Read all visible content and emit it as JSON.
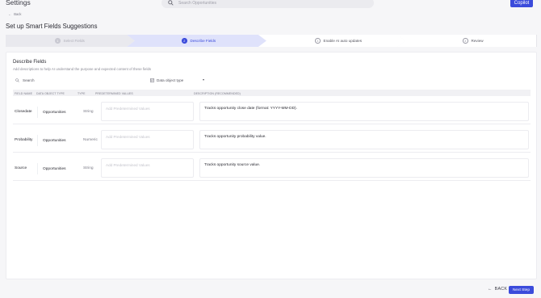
{
  "app": {
    "title": "Settings",
    "copilot_label": "Copilot"
  },
  "search": {
    "placeholder": "Search Opportunities"
  },
  "nav": {
    "back_label": "Back"
  },
  "page": {
    "title": "Set up Smart Fields Suggestions"
  },
  "steps": [
    {
      "number": "1",
      "label": "Select Fields",
      "state": "completed"
    },
    {
      "number": "2",
      "label": "Describe Fields",
      "state": "active"
    },
    {
      "number": "3",
      "label": "Enable AI auto updates",
      "state": "upcoming"
    },
    {
      "number": "4",
      "label": "Review",
      "state": "upcoming"
    }
  ],
  "section": {
    "title": "Describe Fields",
    "subtitle": "Add descriptions to help AI understand the purpose and expected content of these fields"
  },
  "filters": {
    "search_label": "Search",
    "object_type_label": "Data object type"
  },
  "table": {
    "headers": [
      "FIELD NAME",
      "DATA OBJECT TYPE",
      "TYPE",
      "PREDETERMINED VALUES",
      "DESCRIPTION (RECOMMENDED)"
    ],
    "rows": [
      {
        "field_name": "Closedate",
        "object_type": "Opportunities",
        "type": "String",
        "predetermined_placeholder": "Add Predetermined Values",
        "description": "Tracks opportunity close date (format: YYYY-MM-DD)."
      },
      {
        "field_name": "Probability",
        "object_type": "Opportunities",
        "type": "Numeric",
        "predetermined_placeholder": "Add Predetermined Values",
        "description": "Tracks opportunity probability value."
      },
      {
        "field_name": "Source",
        "object_type": "Opportunities",
        "type": "String",
        "predetermined_placeholder": "Add Predetermined Values",
        "description": "Tracks opportunity source value."
      }
    ]
  },
  "footer": {
    "back_label": "BACK",
    "next_label": "Next Step"
  },
  "colors": {
    "accent": "#3b4bdb",
    "active_step_bg": "#dfe2fb"
  }
}
